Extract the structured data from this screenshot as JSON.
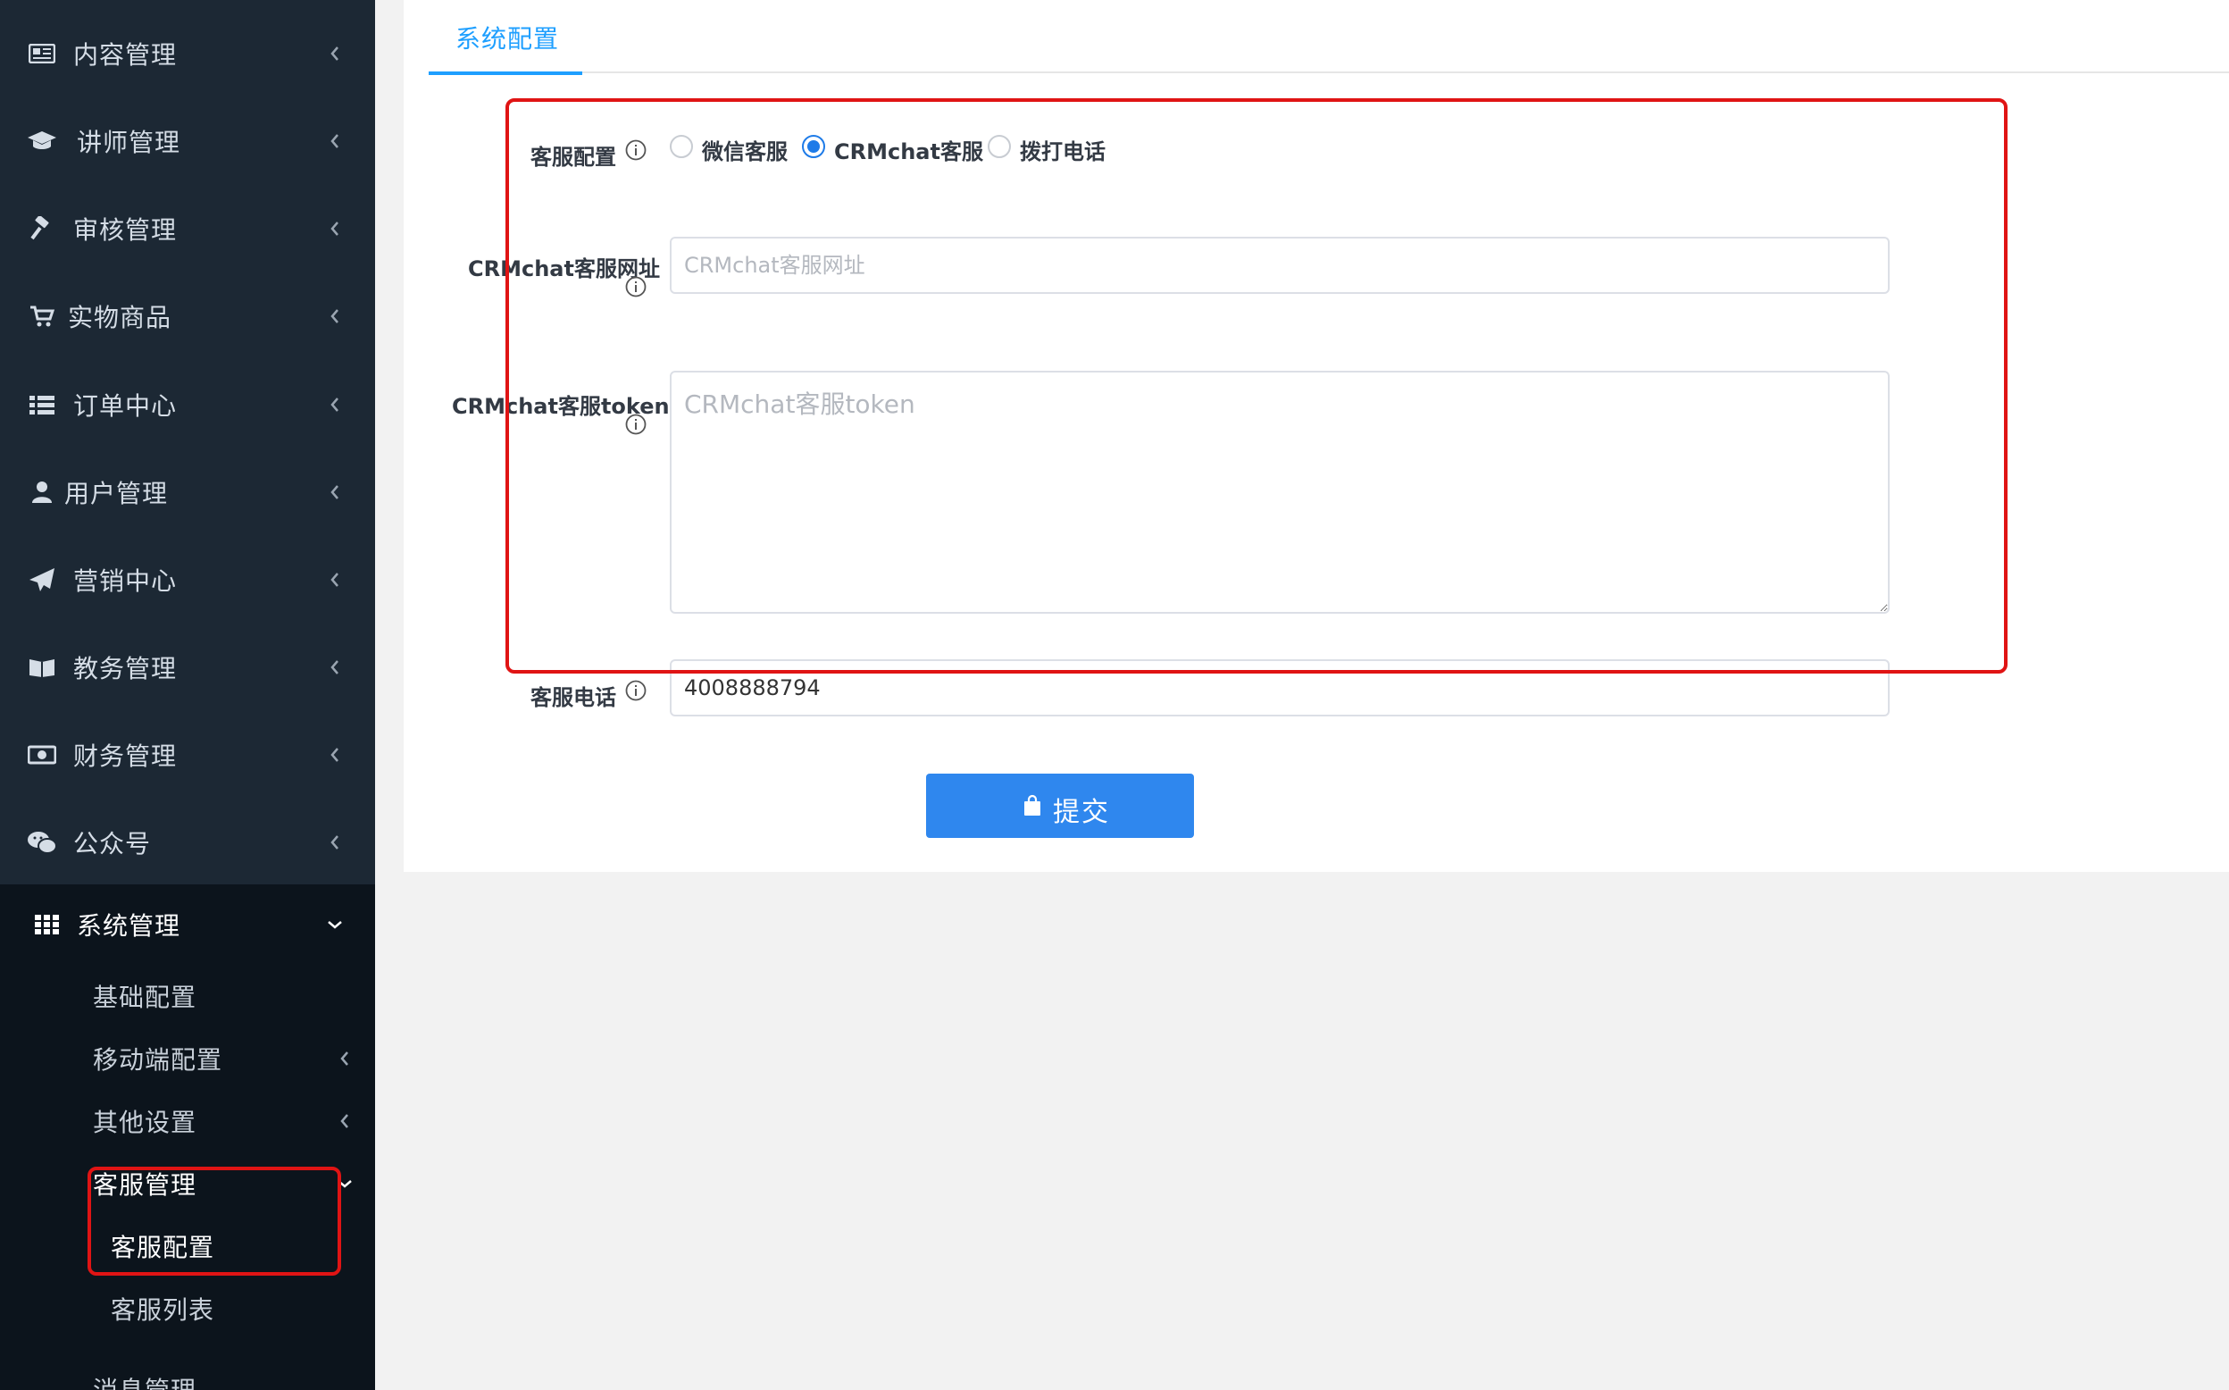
{
  "sidebar": {
    "items": [
      {
        "label": "内容管理",
        "icon": "newspaper-icon"
      },
      {
        "label": "讲师管理",
        "icon": "graduation-cap-icon"
      },
      {
        "label": "审核管理",
        "icon": "gavel-icon"
      },
      {
        "label": "实物商品",
        "icon": "cart-icon"
      },
      {
        "label": "订单中心",
        "icon": "list-icon"
      },
      {
        "label": "用户管理",
        "icon": "user-icon"
      },
      {
        "label": "营销中心",
        "icon": "paper-plane-icon"
      },
      {
        "label": "教务管理",
        "icon": "book-icon"
      },
      {
        "label": "财务管理",
        "icon": "money-icon"
      },
      {
        "label": "公众号",
        "icon": "wechat-icon"
      }
    ],
    "system": {
      "label": "系统管理",
      "icon": "grid-icon",
      "children": [
        {
          "label": "基础配置"
        },
        {
          "label": "移动端配置"
        },
        {
          "label": "其他设置"
        },
        {
          "label": "客服管理"
        },
        {
          "label": "客服配置"
        },
        {
          "label": "客服列表"
        },
        {
          "label": "消息管理"
        }
      ]
    }
  },
  "tabs": [
    {
      "label": "系统配置",
      "active": true
    }
  ],
  "form": {
    "service_config": {
      "label": "客服配置",
      "options": [
        "微信客服",
        "CRMchat客服",
        "拨打电话"
      ],
      "selected": "CRMchat客服"
    },
    "crmchat_url": {
      "label": "CRMchat客服网址",
      "placeholder": "CRMchat客服网址",
      "value": ""
    },
    "crmchat_token": {
      "label": "CRMchat客服token",
      "placeholder": "CRMchat客服token",
      "value": ""
    },
    "service_phone": {
      "label": "客服电话",
      "value": "4008888794"
    },
    "submit_label": "提交"
  },
  "colors": {
    "sidebar_bg": "#1c2834",
    "sidebar_sub_bg": "#0c141c",
    "accent": "#1e9fff",
    "button": "#2f87ee",
    "annotation": "#e01414"
  }
}
